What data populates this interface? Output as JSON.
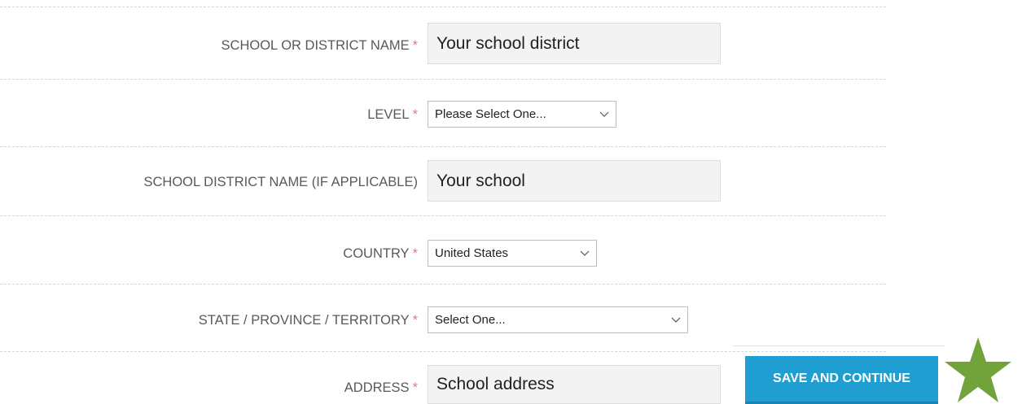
{
  "form": {
    "fields": [
      {
        "label": "SCHOOL OR DISTRICT NAME",
        "required": "*",
        "type": "text",
        "value": "Your school district"
      },
      {
        "label": "LEVEL",
        "required": "*",
        "type": "select",
        "value": "Please Select One..."
      },
      {
        "label": "SCHOOL DISTRICT NAME (IF APPLICABLE)",
        "type": "text",
        "value": "Your school"
      },
      {
        "label": "COUNTRY",
        "required": "*",
        "type": "select",
        "value": "United States"
      },
      {
        "label": "STATE / PROVINCE / TERRITORY",
        "required": "*",
        "type": "select",
        "value": "Select One..."
      },
      {
        "label": "ADDRESS",
        "required": "*",
        "type": "text",
        "value": "School address"
      }
    ],
    "save_label": "SAVE AND CONTINUE"
  },
  "colors": {
    "button": "#1f9fd1",
    "required_mark": "#d98282",
    "star": "#72a33a",
    "label": "#595959"
  },
  "icons": [
    "chevron-down-icon",
    "star-icon"
  ]
}
